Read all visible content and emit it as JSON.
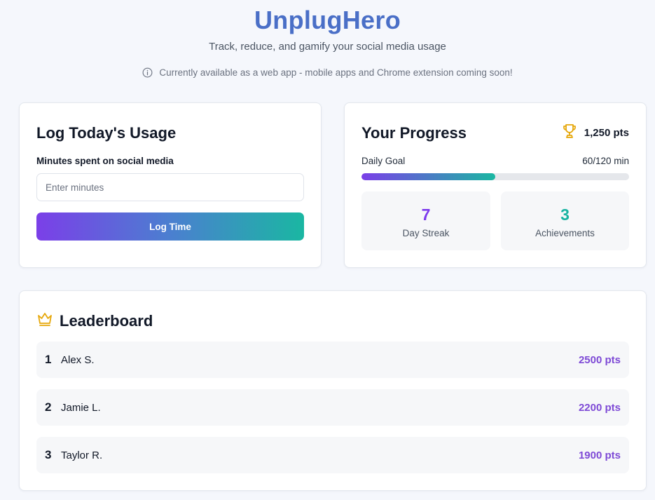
{
  "header": {
    "title": "UnplugHero",
    "tagline": "Track, reduce, and gamify your social media usage",
    "notice": "Currently available as a web app - mobile apps and Chrome extension coming soon!"
  },
  "log_card": {
    "title": "Log Today's Usage",
    "field_label": "Minutes spent on social media",
    "input_value": "",
    "input_placeholder": "Enter minutes",
    "button_label": "Log Time"
  },
  "progress_card": {
    "title": "Your Progress",
    "points": "1,250 pts",
    "daily_goal_label": "Daily Goal",
    "daily_goal_value": "60/120 min",
    "daily_goal_fraction": 0.5,
    "stats": [
      {
        "value": "7",
        "label": "Day Streak"
      },
      {
        "value": "3",
        "label": "Achievements"
      }
    ]
  },
  "leaderboard": {
    "title": "Leaderboard",
    "rows": [
      {
        "rank": "1",
        "name": "Alex S.",
        "points": "2500 pts"
      },
      {
        "rank": "2",
        "name": "Jamie L.",
        "points": "2200 pts"
      },
      {
        "rank": "3",
        "name": "Taylor R.",
        "points": "1900 pts"
      }
    ]
  },
  "colors": {
    "brand_title": "#4a6fc7",
    "accent_purple": "#7c3aed",
    "accent_teal": "#17b3a1",
    "trophy_gold": "#e6a70a",
    "page_background": "#f5f7fc"
  },
  "icons": {
    "notice": "info-icon",
    "points": "trophy-icon",
    "leaderboard": "crown-icon"
  }
}
